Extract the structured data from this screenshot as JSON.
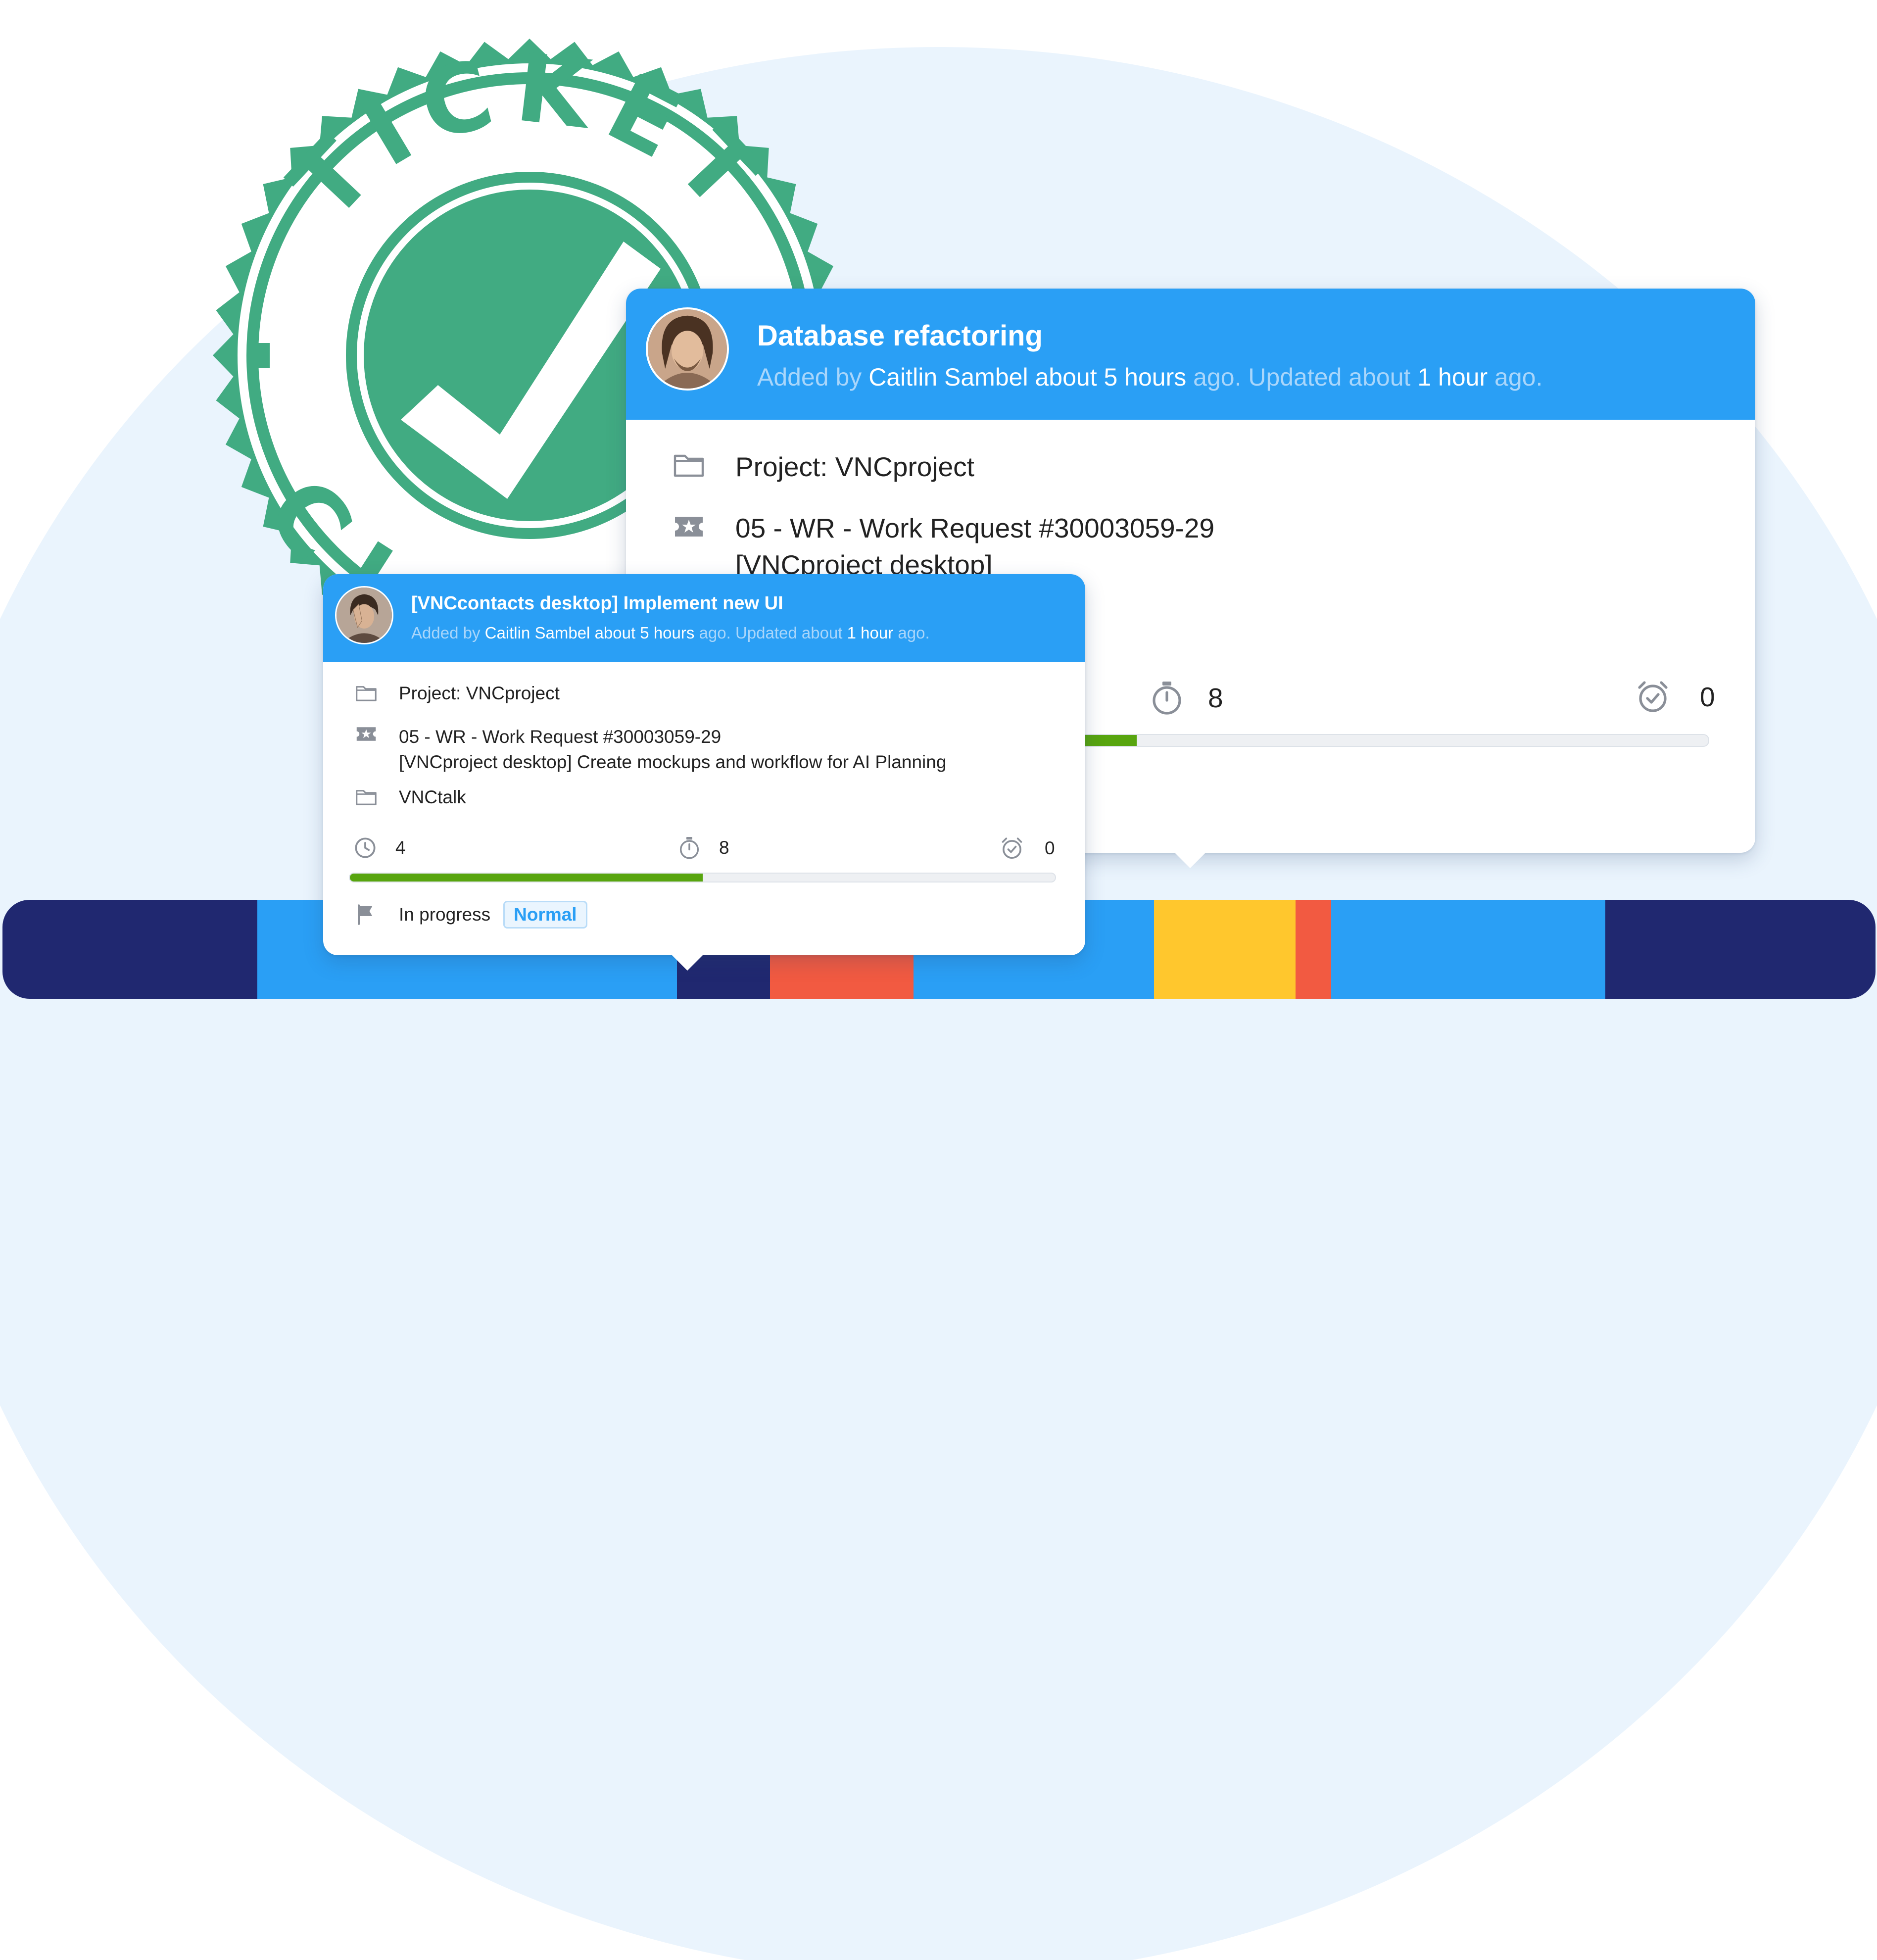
{
  "stamp": {
    "text_top": "TICKET",
    "text_bottom": "CLOSED",
    "color": "#41ab82"
  },
  "timeline": {
    "colors": [
      "#202870",
      "#2a9ff5",
      "#202870",
      "#f25a41",
      "#2a9ff5",
      "#ffc72d",
      "#f25a41",
      "#2a9ff5",
      "#202870"
    ]
  },
  "card_big": {
    "title": "Database refactoring",
    "meta_added": "Added by",
    "meta_author": "Caitlin Sambel",
    "meta_when": "about 5 hours",
    "meta_updated": "ago. Updated about",
    "meta_updated_when": "1 hour",
    "meta_ago": "ago.",
    "project": "Project: VNCproject",
    "work_request_line1": "05 - WR - Work Request #30003059-29",
    "work_request_line2": "[VNCproject desktop]",
    "spent": "8",
    "overdue": "0",
    "progress": 0.45,
    "icons": [
      "folder-icon",
      "ticket-star-icon",
      "stopwatch-icon",
      "alarm-check-icon"
    ]
  },
  "card_small": {
    "title": "[VNCcontacts desktop] Implement new UI",
    "meta_added": "Added by",
    "meta_author": "Caitlin Sambel",
    "meta_when": "about 5 hours",
    "meta_updated": "ago. Updated about",
    "meta_updated_when": "1 hour",
    "meta_ago": "ago.",
    "project": "Project: VNCproject",
    "work_request_line1": "05 - WR - Work Request #30003059-29",
    "work_request_line2": "[VNCproject desktop] Create mockups and workflow for AI Planning",
    "channel": "VNCtalk",
    "estimated": "4",
    "spent": "8",
    "overdue": "0",
    "progress": 0.5,
    "status": "In progress",
    "priority": "Normal",
    "icons": [
      "folder-icon",
      "ticket-star-icon",
      "clock-icon",
      "stopwatch-icon",
      "alarm-check-icon",
      "flag-icon"
    ]
  },
  "colors": {
    "header_blue": "#2a9ff5",
    "progress_green": "#58a50f",
    "background_arc": "#eaf4fd",
    "navy": "#202870"
  }
}
